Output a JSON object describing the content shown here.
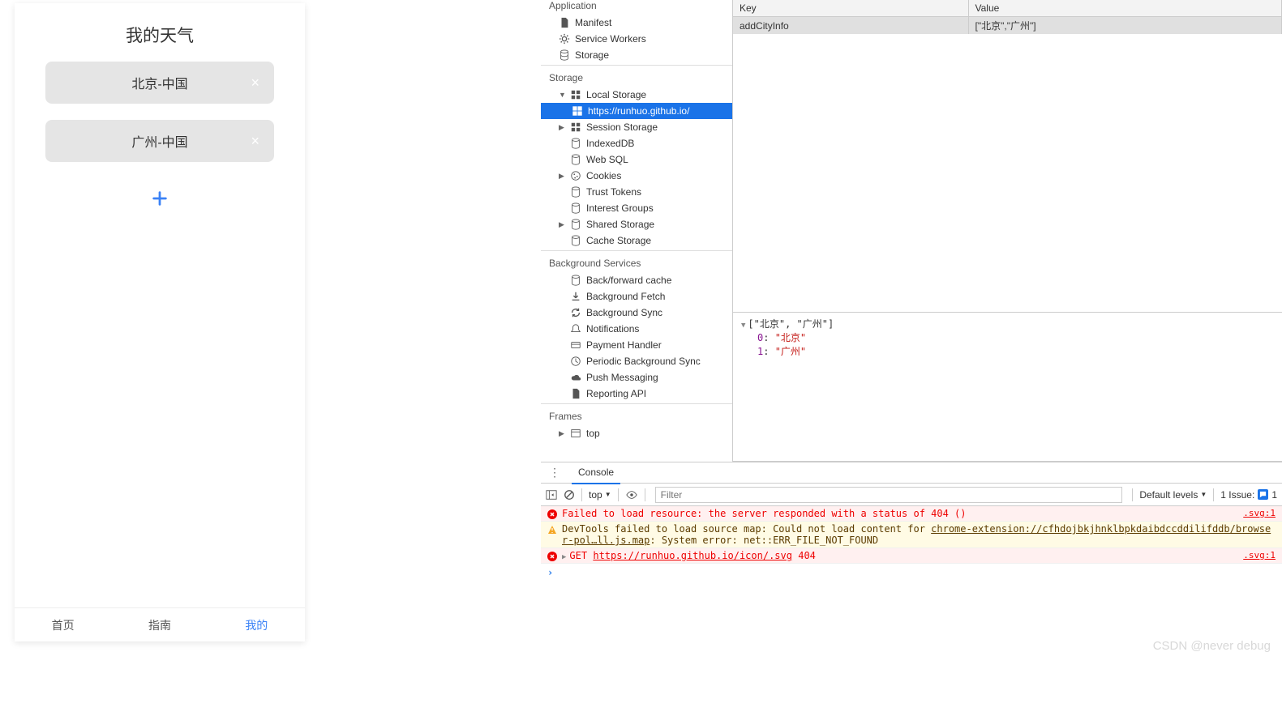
{
  "mobile": {
    "title": "我的天气",
    "cities": [
      "北京-中国",
      "广州-中国"
    ],
    "tabs": [
      "首页",
      "指南",
      "我的"
    ],
    "active_tab_index": 2
  },
  "app_tree": {
    "application_heading": "Application",
    "application_items": [
      "Manifest",
      "Service Workers",
      "Storage"
    ],
    "storage_heading": "Storage",
    "local_storage": "Local Storage",
    "local_storage_origin": "https://runhuo.github.io/",
    "session_storage": "Session Storage",
    "indexeddb": "IndexedDB",
    "websql": "Web SQL",
    "cookies": "Cookies",
    "trust_tokens": "Trust Tokens",
    "interest_groups": "Interest Groups",
    "shared_storage": "Shared Storage",
    "cache_storage": "Cache Storage",
    "bg_heading": "Background Services",
    "bg_items": [
      "Back/forward cache",
      "Background Fetch",
      "Background Sync",
      "Notifications",
      "Payment Handler",
      "Periodic Background Sync",
      "Push Messaging",
      "Reporting API"
    ],
    "frames_heading": "Frames",
    "frames_top": "top"
  },
  "storage_table": {
    "cols": [
      "Key",
      "Value"
    ],
    "rows": [
      {
        "key": "addCityInfo",
        "value": "[\"北京\",\"广州\"]"
      }
    ]
  },
  "preview": {
    "header": "[\"北京\", \"广州\"]",
    "items": [
      {
        "idx": "0",
        "val": "\"北京\""
      },
      {
        "idx": "1",
        "val": "\"广州\""
      }
    ]
  },
  "console": {
    "tab": "Console",
    "context": "top",
    "filter_placeholder": "Filter",
    "levels": "Default levels",
    "issues_label": "1 Issue:",
    "issues_count": "1",
    "logs": [
      {
        "type": "err",
        "msg": "Failed to load resource: the server responded with a status of 404 ()",
        "src": ".svg:1"
      },
      {
        "type": "warn",
        "msg_pre": "DevTools failed to load source map: Could not load content for ",
        "link": "chrome-extension://cfhdojbkjhnklbpkdaibdccddilifddb/browser-pol…ll.js.map",
        "msg_post": ": System error: net::ERR_FILE_NOT_FOUND",
        "src": ""
      },
      {
        "type": "err",
        "arrow": true,
        "method": "GET",
        "link": "https://runhuo.github.io/icon/.svg",
        "code": "404",
        "src": ".svg:1"
      }
    ]
  },
  "watermark": "CSDN @never debug"
}
